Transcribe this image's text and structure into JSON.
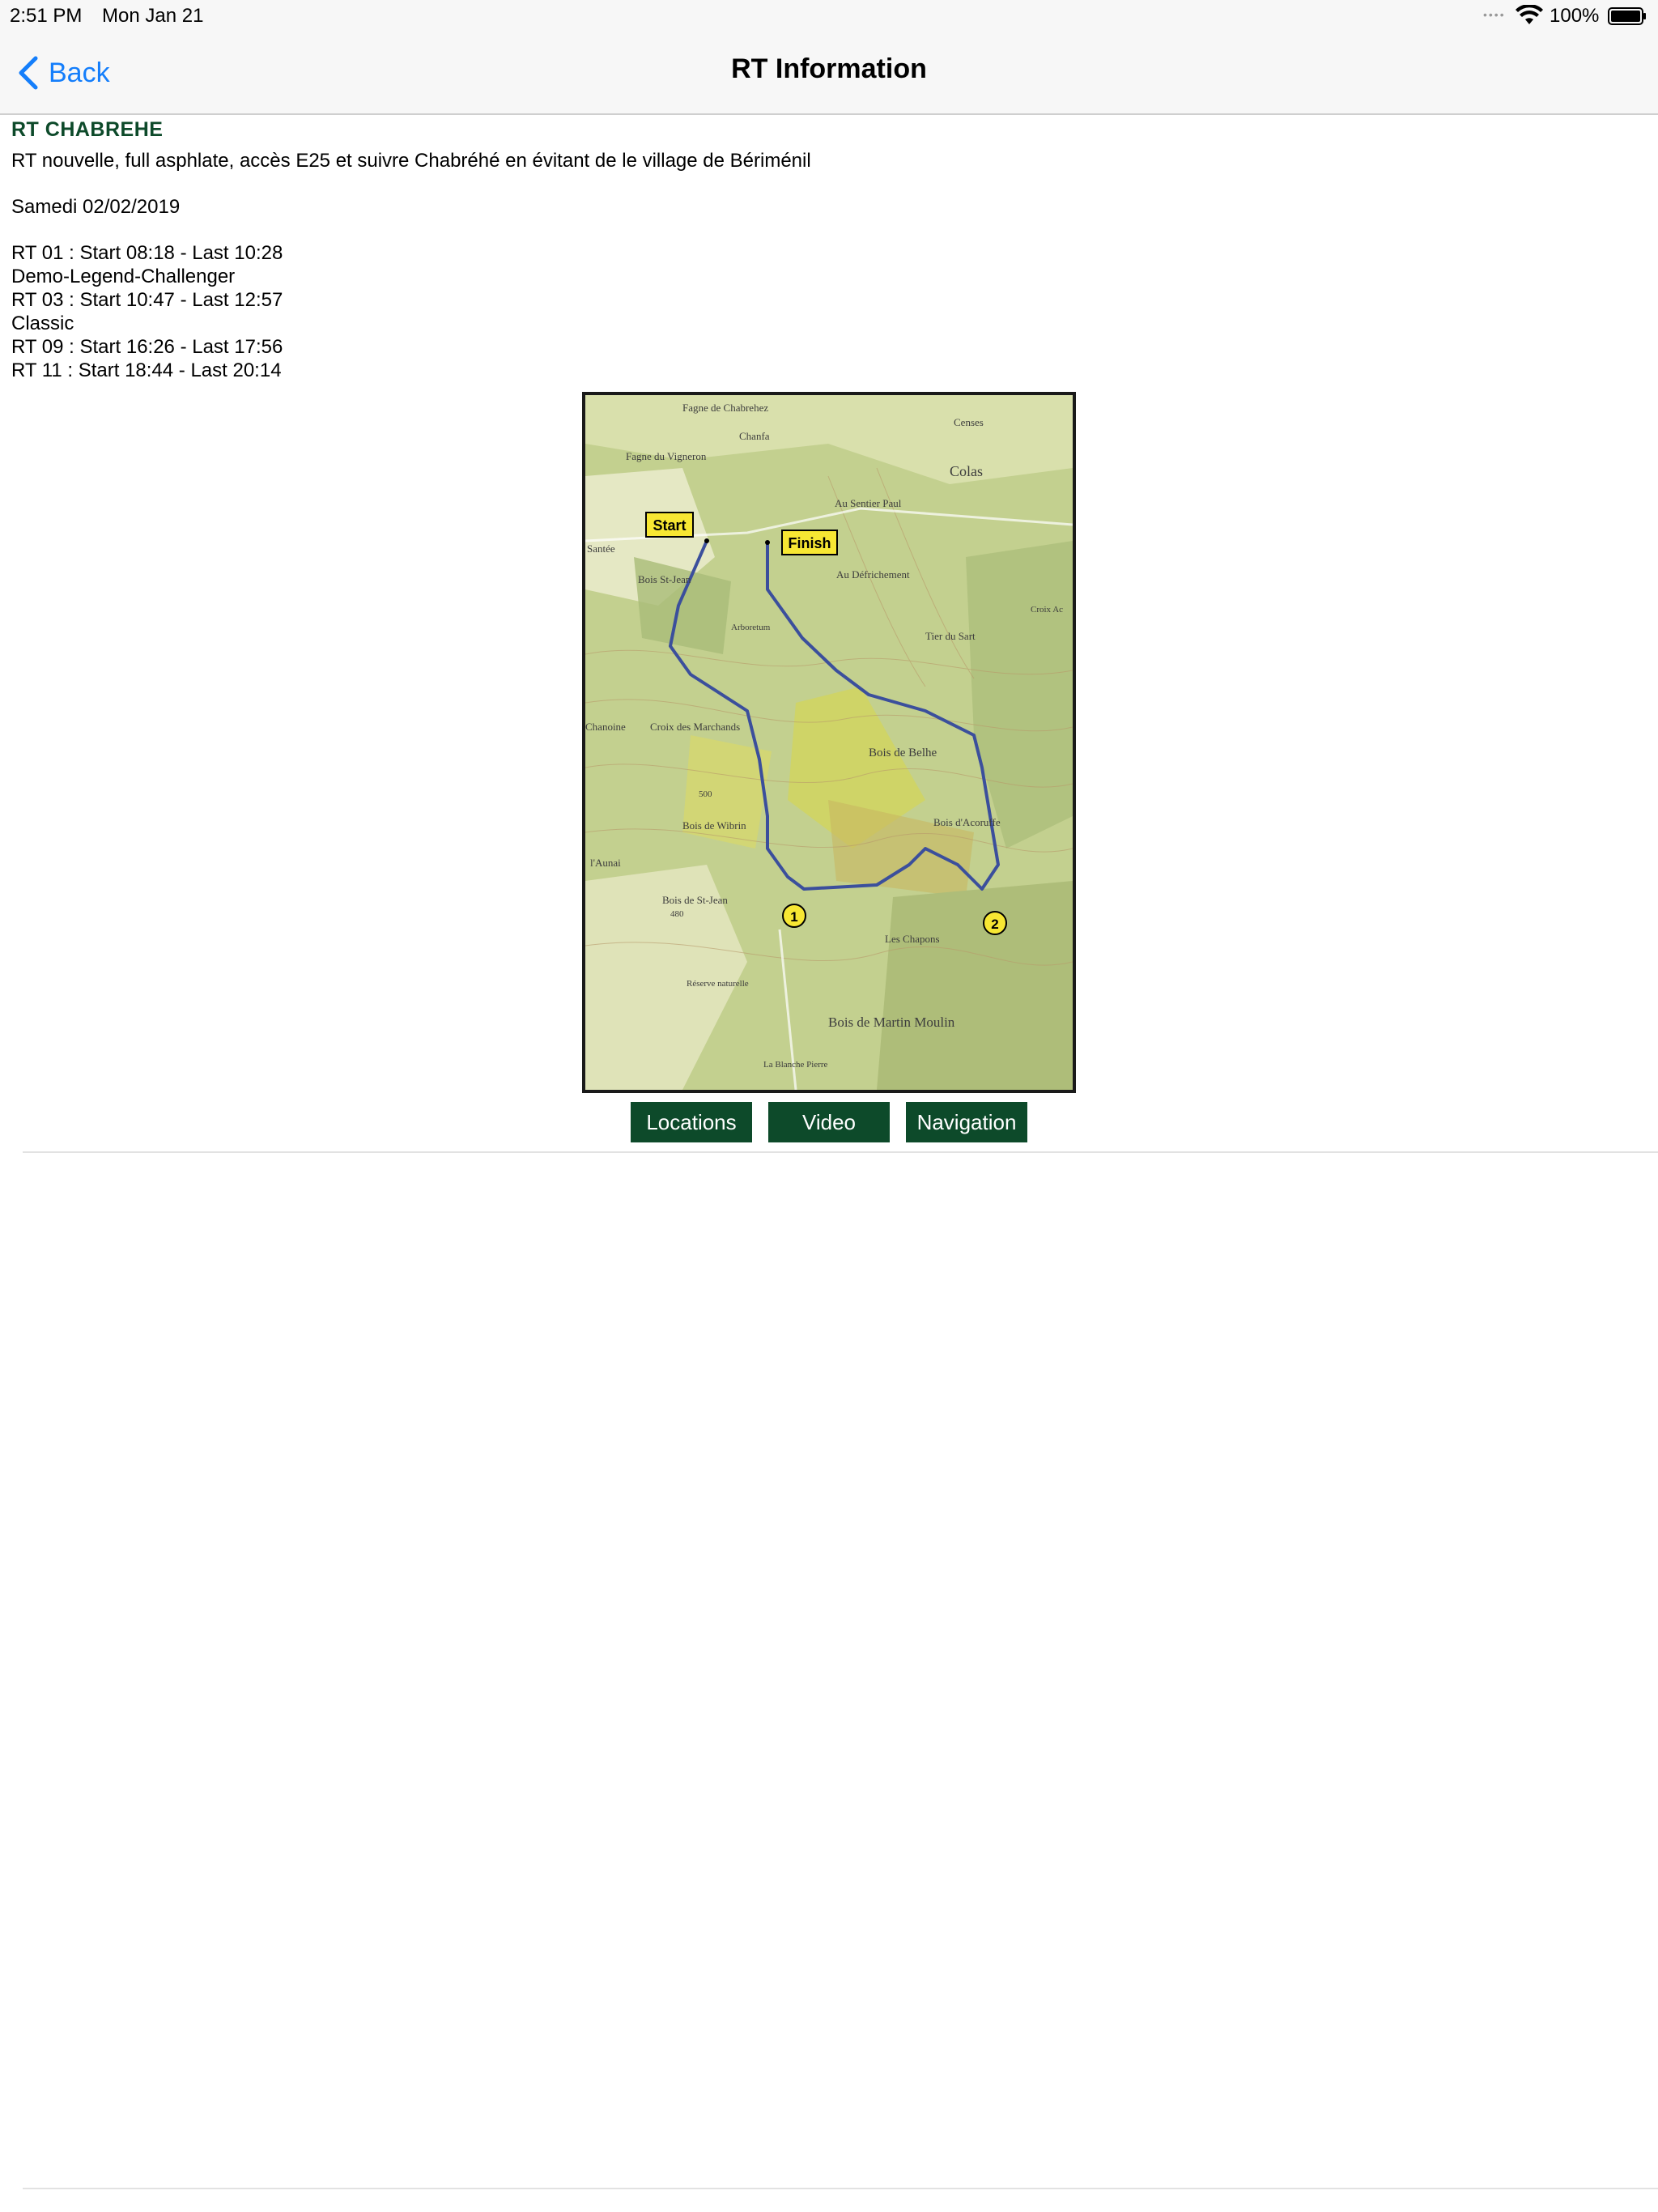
{
  "status_bar": {
    "time": "2:51 PM",
    "date": "Mon Jan 21",
    "battery": "100%"
  },
  "nav": {
    "back_label": "Back",
    "title": "RT Information"
  },
  "rt": {
    "title": "RT CHABREHE",
    "description": "RT nouvelle, full asphlate, accès E25 et suivre Chabréhé en évitant de le village de Bériménil",
    "date": "Samedi 02/02/2019",
    "schedule": [
      "RT 01 : Start 08:18 - Last 10:28",
      "Demo-Legend-Challenger",
      "RT 03 : Start 10:47 - Last 12:57",
      "Classic",
      "RT 09 : Start 16:26 - Last 17:56",
      "RT 11 : Start 18:44 - Last 20:14"
    ]
  },
  "map": {
    "labels": {
      "start": "Start",
      "finish": "Finish",
      "marker_1": "1",
      "marker_2": "2"
    },
    "place_names": [
      "Fagne de Chabrehez",
      "Censes",
      "Chanfa",
      "Fagne du Vigneron",
      "Colas",
      "Au Sentier Paul",
      "Santée",
      "Au Défrichement",
      "Bois St-Jean",
      "Arboretum",
      "Tier du Sart",
      "Croix Ac",
      "Chanoine",
      "Croix des Marchands",
      "Bois de Belhe",
      "500",
      "Bois de Wibrin",
      "Bois d'Acoruffe",
      "l'Aunai",
      "Bois de St-Jean",
      "480",
      "Les Chapons",
      "Réserve naturelle",
      "Bois de Martin Moulin",
      "La Blanche Pierre"
    ],
    "colors": {
      "route": "#3b4f9c",
      "marker": "#f7e733",
      "forest": "#b7c98a",
      "open": "#e8ecc7",
      "yellow_forest": "#d6d65a"
    }
  },
  "buttons": {
    "locations": "Locations",
    "video": "Video",
    "navigation": "Navigation"
  },
  "theme": {
    "accent": "#0d4a2a",
    "link": "#147efb"
  }
}
